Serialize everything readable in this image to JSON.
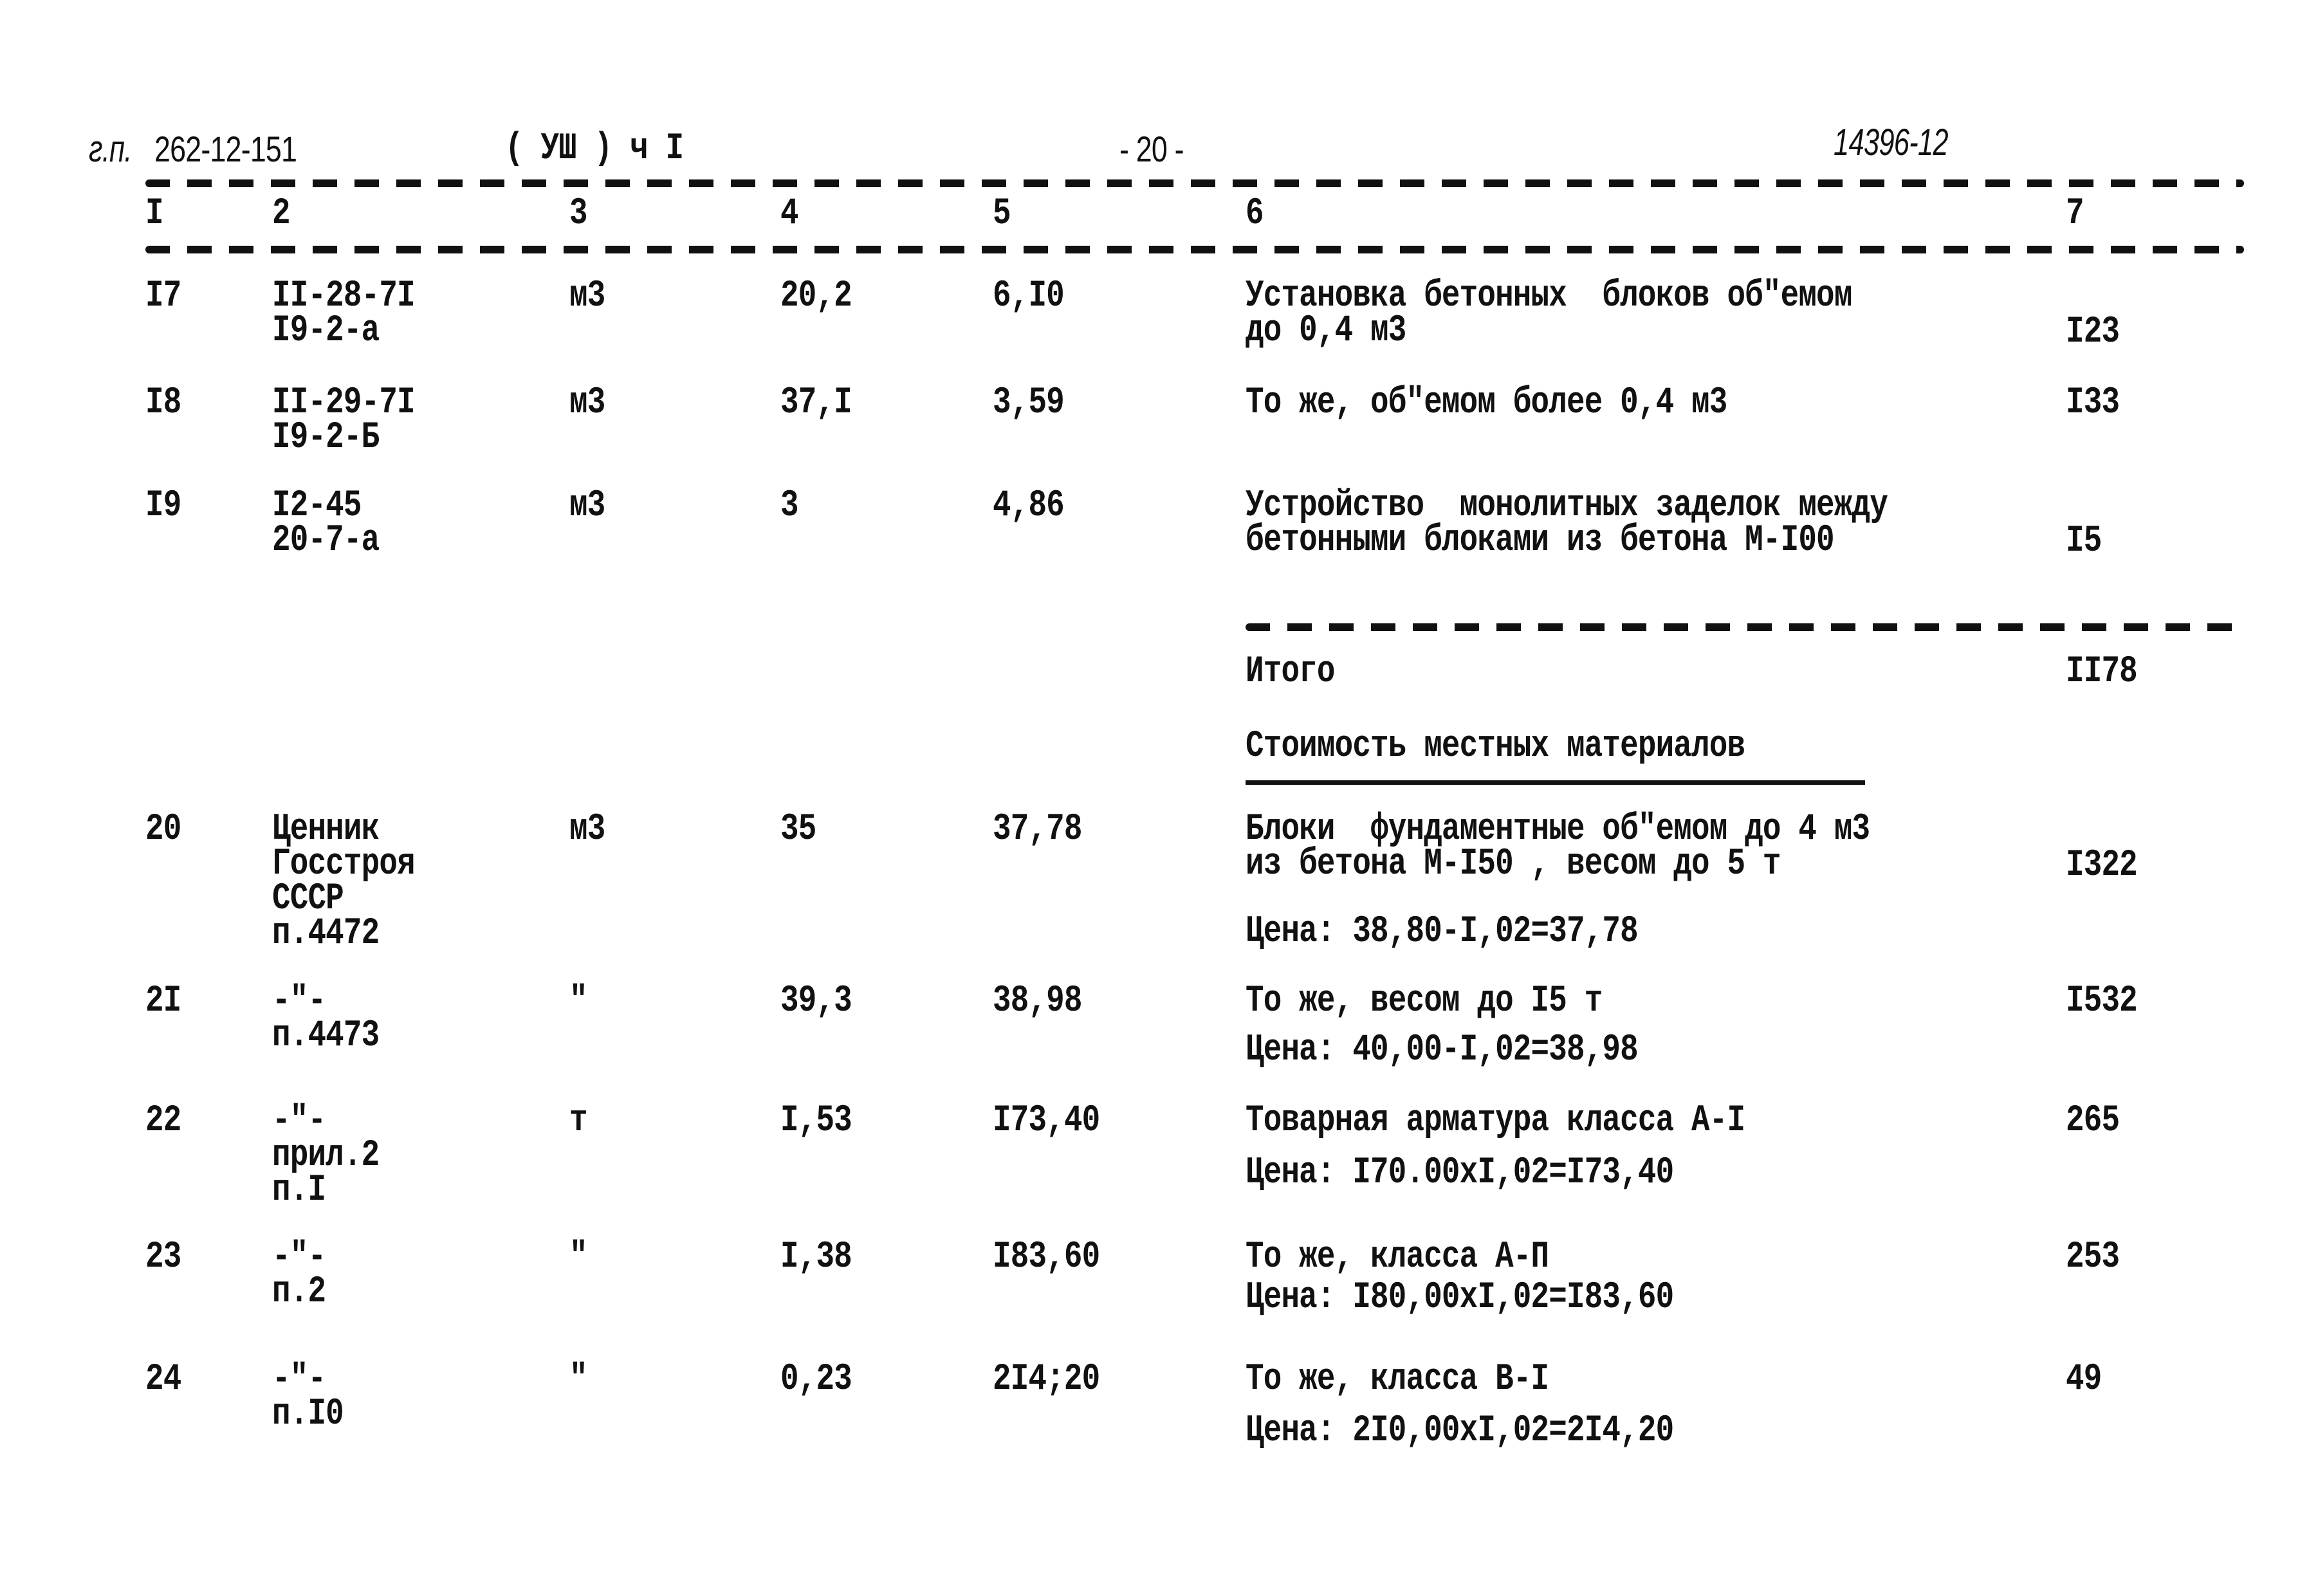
{
  "header": {
    "doc_prefix": "г.п.",
    "doc_number": "262-12-151",
    "section": "( УШ ) ч I",
    "page": "- 20 -",
    "inventory": "14396-12"
  },
  "columns": [
    "I",
    "2",
    "3",
    "4",
    "5",
    "6",
    "7"
  ],
  "rows_part1": [
    {
      "n": "I7",
      "ref": [
        "II-28-7I",
        "I9-2-а"
      ],
      "unit": "м3",
      "qty": "20,2",
      "price": "6,I0",
      "desc": [
        "Установка бетонных  блоков об\"емом",
        "до 0,4 м3"
      ],
      "price_note": "",
      "total": "I23"
    },
    {
      "n": "I8",
      "ref": [
        "II-29-7I",
        "I9-2-Б"
      ],
      "unit": "м3",
      "qty": "37,I",
      "price": "3,59",
      "desc": [
        "То же, об\"емом более 0,4 м3"
      ],
      "price_note": "",
      "total": "I33"
    },
    {
      "n": "I9",
      "ref": [
        "I2-45",
        "20-7-а"
      ],
      "unit": "м3",
      "qty": "3",
      "price": "4,86",
      "desc": [
        "Устройство  монолитных заделок между",
        "бетонными блоками из бетона М-I00"
      ],
      "price_note": "",
      "total": "I5"
    }
  ],
  "subtotal": {
    "label": "Итого",
    "value": "II78"
  },
  "section_title": "Стоимость местных материалов",
  "rows_part2": [
    {
      "n": "20",
      "ref": [
        "Ценник",
        "Госстроя",
        "СССР",
        "п.4472"
      ],
      "unit": "м3",
      "qty": "35",
      "price": "37,78",
      "desc": [
        "Блоки  фундаментные об\"емом до 4 м3",
        "из бетона М-I50 , весом до 5 т"
      ],
      "price_note": "Цена: 38,80-I,02=37,78",
      "total": "I322"
    },
    {
      "n": "2I",
      "ref": [
        "-\"-",
        "п.4473"
      ],
      "unit": "\"",
      "qty": "39,3",
      "price": "38,98",
      "desc": [
        "То же, весом до I5 т"
      ],
      "price_note": "Цена: 40,00-I,02=38,98",
      "total": "I532"
    },
    {
      "n": "22",
      "ref": [
        "-\"-",
        "прил.2",
        "п.I"
      ],
      "unit": "т",
      "qty": "I,53",
      "price": "I73,40",
      "desc": [
        "Товарная арматура класса А-I"
      ],
      "price_note": "Цена: I70.00xI,02=I73,40",
      "total": "265"
    },
    {
      "n": "23",
      "ref": [
        "-\"-",
        "п.2"
      ],
      "unit": "\"",
      "qty": "I,38",
      "price": "I83,60",
      "desc": [
        "То же, класса А-П"
      ],
      "price_note": "Цена: I80,00xI,02=I83,60",
      "total": "253"
    },
    {
      "n": "24",
      "ref": [
        "-\"-",
        "п.I0"
      ],
      "unit": "\"",
      "qty": "0,23",
      "price": "2I4;20",
      "desc": [
        "То же, класса В-I"
      ],
      "price_note": "Цена: 2I0,00xI,02=2I4,20",
      "total": "49"
    }
  ]
}
